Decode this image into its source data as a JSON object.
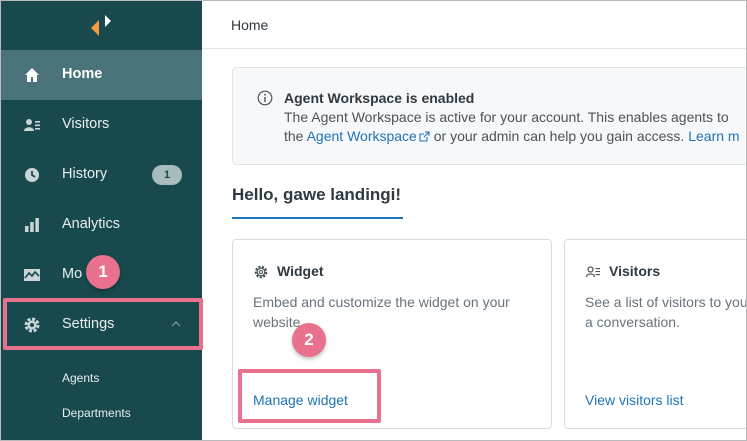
{
  "sidebar": {
    "items": [
      {
        "label": "Home",
        "icon": "home-icon"
      },
      {
        "label": "Visitors",
        "icon": "visitors-icon"
      },
      {
        "label": "History",
        "icon": "clock-icon",
        "badge": "1"
      },
      {
        "label": "Analytics",
        "icon": "bar-chart-icon"
      },
      {
        "label": "Mo",
        "icon": "monitor-icon"
      },
      {
        "label": "Settings",
        "icon": "gear-icon"
      }
    ],
    "subitems": [
      "Agents",
      "Departments"
    ]
  },
  "callouts": {
    "step1": "1",
    "step2": "2",
    "color": "#e8718d"
  },
  "header": {
    "title": "Home"
  },
  "banner": {
    "title": "Agent Workspace is enabled",
    "line1": "The Agent Workspace is active for your account. This enables agents to",
    "line2_prefix": "the ",
    "line2_link": "Agent Workspace",
    "line2_mid": " or your admin can help you gain access. ",
    "line2_link2": "Learn m"
  },
  "greeting": "Hello, gawe landingi!",
  "cards": [
    {
      "title": "Widget",
      "icon": "gear-icon",
      "description": "Embed and customize the widget on your website.",
      "link": "Manage widget"
    },
    {
      "title": "Visitors",
      "icon": "visitors-list-icon",
      "description": "See a list of visitors to your website and start a conversation.",
      "link": "View visitors list"
    }
  ],
  "colors": {
    "sidebar_bg": "#17494d",
    "active_item": "#4a7479",
    "link": "#1f73b7"
  }
}
